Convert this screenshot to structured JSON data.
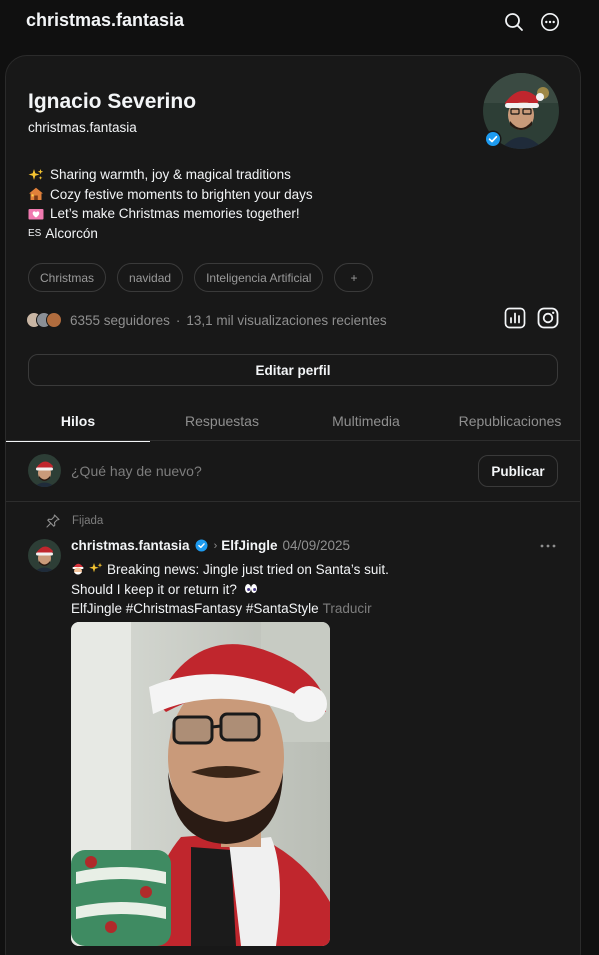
{
  "topbar": {
    "title": "christmas.fantasia",
    "icons": [
      "search-icon",
      "more-circle-icon"
    ]
  },
  "profile": {
    "name": "Ignacio Severino",
    "handle": "christmas.fantasia",
    "verified": true,
    "bio": [
      {
        "icon": "sparkles-icon",
        "text": "Sharing warmth, joy & magical traditions"
      },
      {
        "icon": "house-icon",
        "text": "Cozy festive moments to brighten your days"
      },
      {
        "icon": "heart-letter-icon",
        "text": "Let’s make Christmas memories together!"
      },
      {
        "prefix": "ES",
        "text": "Alcorcón"
      }
    ],
    "tags": [
      "Christmas",
      "navidad",
      "Inteligencia Artificial",
      "+"
    ],
    "followers": "6355 seguidores",
    "separator": "·",
    "views": "13,1 mil visualizaciones recientes",
    "edit_label": "Editar perfil"
  },
  "tabs": [
    {
      "label": "Hilos",
      "active": true
    },
    {
      "label": "Respuestas",
      "active": false
    },
    {
      "label": "Multimedia",
      "active": false
    },
    {
      "label": "Republicaciones",
      "active": false
    }
  ],
  "composer": {
    "placeholder": "¿Qué hay de nuevo?",
    "publish_label": "Publicar"
  },
  "post": {
    "pinned_label": "Fijada",
    "author": "christmas.fantasia",
    "chevron": "›",
    "mention": "ElfJingle",
    "date": "04/09/2025",
    "line1": "Breaking news: Jingle just tried on Santa’s suit.",
    "line2": "Should I keep it or return it?",
    "line3": "ElfJingle #ChristmasFantasy #SantaStyle",
    "translate_label": "Traducir"
  },
  "colors": {
    "background": "#101010",
    "panel": "#181818",
    "border": "#2b2b2b",
    "text": "#f3f5f7",
    "muted": "#8f8f8f",
    "verified": "#1d9bf0"
  }
}
